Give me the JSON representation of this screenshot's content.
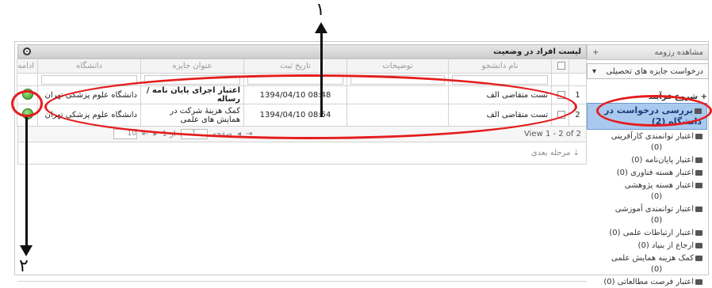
{
  "side_panel": {
    "header_title": "مشاهده رزومه",
    "header_button": "+",
    "select_label": "درخواست جایزه های تحصیلی",
    "tree_root": "شروع فرآیند",
    "nodes": [
      {
        "label": "بررسی درخواست در دانشگاه (2)",
        "selected": true
      },
      {
        "label": "اعتبار توانمندی کارآفرینی",
        "count": "(0)"
      },
      {
        "label": "اعتبار پایان‌نامه (0)"
      },
      {
        "label": "اعتبار هسته فناوری (0)"
      },
      {
        "label": "اعتبار هسته پژوهشی",
        "count": "(0)"
      },
      {
        "label": "اعتبار توانمندی آموزشی",
        "count": "(0)"
      },
      {
        "label": "اعتبار ارتباطات علمی (0)"
      },
      {
        "label": "ارجاع از بنیاد (0)"
      },
      {
        "label": "کمک هزینه همایش علمی",
        "count": "(0)"
      },
      {
        "label": "اعتبار فرصت مطالعاتی (0)"
      }
    ]
  },
  "grid": {
    "title": "لیست افراد در وضعیت",
    "columns": [
      "نام دانشجو",
      "توضیحات",
      "تاریخ ثبت",
      "عنوان جایزه",
      "دانشگاه",
      "ادامه"
    ],
    "rows": [
      {
        "index": "1",
        "student": "تست متقاضی الف",
        "notes": "",
        "date": "08:48 1394/04/10",
        "award": "اعتبار اجرای پایان نامه / رساله",
        "university": "دانشگاه علوم پزشکی تهران"
      },
      {
        "index": "2",
        "student": "تست متقاضی الف",
        "notes": "",
        "date": "08:54 1394/04/10",
        "award": "کمک هزینهٔ شرکت در همایش های علمی",
        "university": "دانشگاه علوم پزشکی تهران"
      }
    ],
    "pager": {
      "view_text": "View 1 - 2 of 2",
      "page_label": "صفحه",
      "page_value": "1",
      "of_label": "از 1",
      "page_size": "10"
    },
    "next_step_label": "مرحله بعدی"
  },
  "annotations": {
    "label_1": "۱",
    "label_2": "۲",
    "color": "#e41d1d"
  }
}
